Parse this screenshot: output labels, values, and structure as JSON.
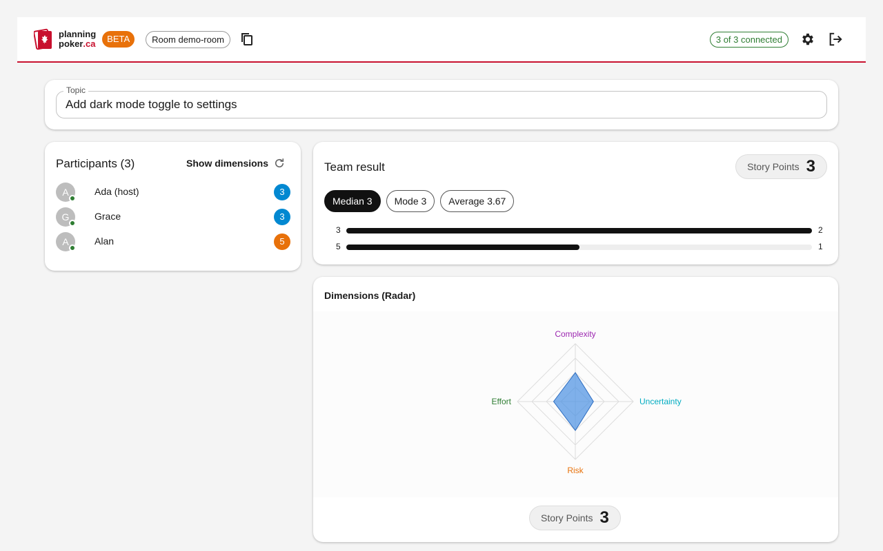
{
  "header": {
    "logo_line1": "planning",
    "logo_line2_main": "poker",
    "logo_line2_accent": ".ca",
    "beta_label": "BETA",
    "room_label": "Room demo-room",
    "connected_label": "3 of 3 connected",
    "accent_color": "#c8102e"
  },
  "topic": {
    "label": "Topic",
    "value": "Add dark mode toggle to settings"
  },
  "participants": {
    "title": "Participants (3)",
    "show_dimensions_label": "Show dimensions",
    "items": [
      {
        "initial": "A",
        "name": "Ada (host)",
        "vote": "3",
        "vote_color": "#0288d1"
      },
      {
        "initial": "G",
        "name": "Grace",
        "vote": "3",
        "vote_color": "#0288d1"
      },
      {
        "initial": "A",
        "name": "Alan",
        "vote": "5",
        "vote_color": "#e8710a"
      }
    ]
  },
  "result": {
    "title": "Team result",
    "story_points_label": "Story Points",
    "story_points_value": "3",
    "stats": [
      {
        "label": "Median 3",
        "active": true
      },
      {
        "label": "Mode 3",
        "active": false
      },
      {
        "label": "Average 3.67",
        "active": false
      }
    ],
    "distribution": [
      {
        "value": "3",
        "count": "2",
        "fraction": 1.0
      },
      {
        "value": "5",
        "count": "1",
        "fraction": 0.5
      }
    ]
  },
  "radar": {
    "title": "Dimensions (Radar)",
    "story_points_label": "Story Points",
    "story_points_value": "3",
    "fill_color": "#4a90e2"
  },
  "chart_data": {
    "type": "radar",
    "title": "Dimensions (Radar)",
    "axes": [
      {
        "name": "Complexity",
        "color": "#9c27b0"
      },
      {
        "name": "Uncertainty",
        "color": "#00acc1"
      },
      {
        "name": "Risk",
        "color": "#e8710a"
      },
      {
        "name": "Effort",
        "color": "#2e7d32"
      }
    ],
    "rings": 4,
    "max": 4,
    "values": [
      2.0,
      1.25,
      2.0,
      1.5
    ]
  }
}
